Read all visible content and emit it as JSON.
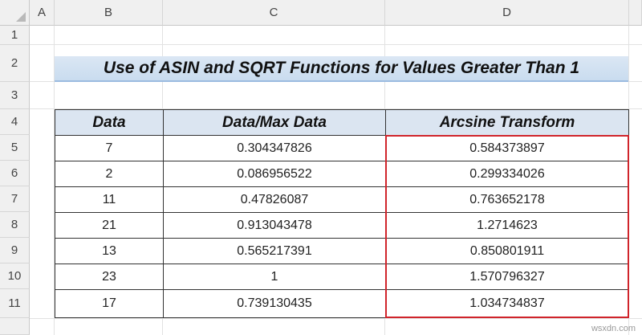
{
  "columns": [
    "A",
    "B",
    "C",
    "D"
  ],
  "rows": [
    "1",
    "2",
    "3",
    "4",
    "5",
    "6",
    "7",
    "8",
    "9",
    "10",
    "11"
  ],
  "title": "Use of ASIN and SQRT Functions for Values Greater Than 1",
  "table": {
    "headers": [
      "Data",
      "Data/Max Data",
      "Arcsine Transform"
    ],
    "data": [
      [
        "7",
        "0.304347826",
        "0.584373897"
      ],
      [
        "2",
        "0.086956522",
        "0.299334026"
      ],
      [
        "11",
        "0.47826087",
        "0.763652178"
      ],
      [
        "21",
        "0.913043478",
        "1.2714623"
      ],
      [
        "13",
        "0.565217391",
        "0.850801911"
      ],
      [
        "23",
        "1",
        "1.570796327"
      ],
      [
        "17",
        "0.739130435",
        "1.034734837"
      ]
    ]
  },
  "highlight_color": "#d0242b",
  "watermark": "wsxdn.com"
}
